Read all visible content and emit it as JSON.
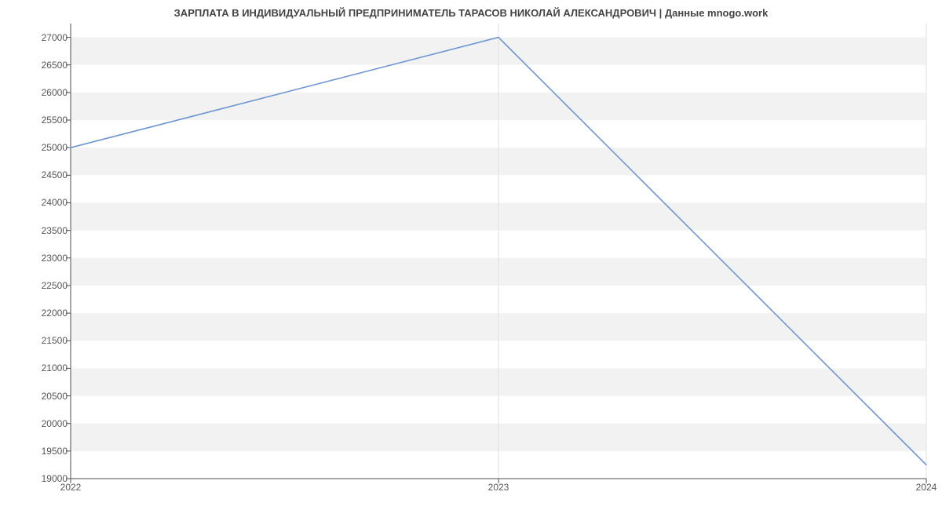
{
  "chart_data": {
    "type": "line",
    "title": "ЗАРПЛАТА В ИНДИВИДУАЛЬНЫЙ ПРЕДПРИНИМАТЕЛЬ ТАРАСОВ НИКОЛАЙ АЛЕКСАНДРОВИЧ | Данные mnogo.work",
    "x": [
      2022,
      2023,
      2024
    ],
    "values": [
      25000,
      27000,
      19250
    ],
    "x_ticks": [
      2022,
      2023,
      2024
    ],
    "y_ticks": [
      19000,
      19500,
      20000,
      20500,
      21000,
      21500,
      22000,
      22500,
      23000,
      23500,
      24000,
      24500,
      25000,
      25500,
      26000,
      26500,
      27000
    ],
    "xlim": [
      2022,
      2024
    ],
    "ylim": [
      19000,
      27250
    ],
    "xlabel": "",
    "ylabel": "",
    "line_color": "#6f97d1",
    "band_color": "#f2f2f2",
    "bg_color": "#ffffff",
    "axis_color": "#4c4c4c",
    "grid_color": "#e0e0e0"
  }
}
